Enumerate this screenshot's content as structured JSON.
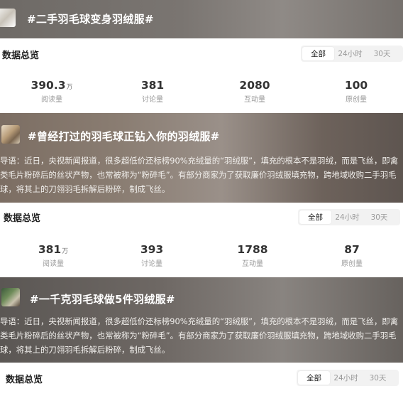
{
  "topics": [
    {
      "title": "#二手羽毛球变身羽绒服#",
      "stats_header": "数据总览",
      "tabs": [
        "全部",
        "24小时",
        "30天"
      ],
      "active_tab": "全部",
      "stats": [
        {
          "value": "390.3",
          "unit": "万",
          "label": "阅读量"
        },
        {
          "value": "381",
          "unit": "",
          "label": "讨论量"
        },
        {
          "value": "2080",
          "unit": "",
          "label": "互动量"
        },
        {
          "value": "100",
          "unit": "",
          "label": "原创量"
        }
      ]
    },
    {
      "title": "#曾经打过的羽毛球正钻入你的羽绒服#",
      "desc_lines": [
        "导语：近日，央视新闻报道，很多超低价还标榜90%充绒量的“羽绒服”，填充的根本不是羽绒，而是飞丝，即禽",
        "类毛片粉碎后的丝状产物，也常被称为“粉碎毛”。有部分商家为了获取廉价羽绒服填充物，跨地域收购二手羽毛",
        "球，将其上的刀翎羽毛拆解后粉碎，制成飞丝。"
      ],
      "stats_header": "数据总览",
      "tabs": [
        "全部",
        "24小时",
        "30天"
      ],
      "active_tab": "全部",
      "stats": [
        {
          "value": "381",
          "unit": "万",
          "label": "阅读量"
        },
        {
          "value": "393",
          "unit": "",
          "label": "讨论量"
        },
        {
          "value": "1788",
          "unit": "",
          "label": "互动量"
        },
        {
          "value": "87",
          "unit": "",
          "label": "原创量"
        }
      ]
    },
    {
      "title": "#一千克羽毛球做5件羽绒服#",
      "desc_lines": [
        "导语：近日，央视新闻报道，很多超低价还标榜90%充绒量的“羽绒服”，填充的根本不是羽绒，而是飞丝，即禽",
        "类毛片粉碎后的丝状产物，也常被称为“粉碎毛”。有部分商家为了获取廉价羽绒服填充物，跨地域收购二手羽毛",
        "球，将其上的刀翎羽毛拆解后粉碎，制成飞丝。"
      ],
      "stats_header": "数据总览",
      "tabs": [
        "全部",
        "24小时",
        "30天"
      ],
      "active_tab": "全部"
    }
  ]
}
